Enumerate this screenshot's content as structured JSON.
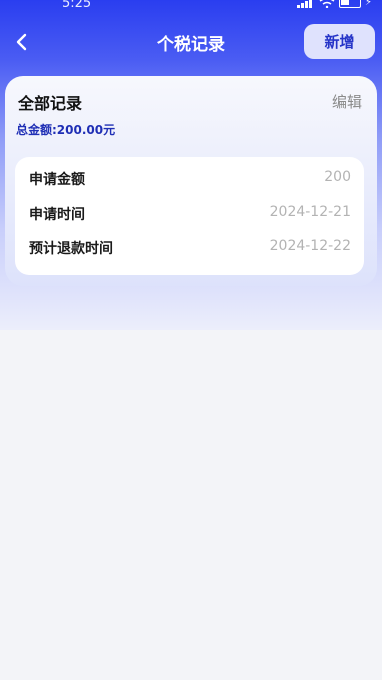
{
  "status": {
    "time": "5:25"
  },
  "nav": {
    "title": "个税记录",
    "add_label": "新增"
  },
  "records": {
    "title": "全部记录",
    "edit_label": "编辑",
    "total": "总金额:200.00元",
    "items": [
      {
        "rows": [
          {
            "label": "申请金额",
            "value": "200"
          },
          {
            "label": "申请时间",
            "value": "2024-12-21"
          },
          {
            "label": "预计退款时间",
            "value": "2024-12-22"
          }
        ]
      }
    ]
  },
  "colors": {
    "header_gradient_top": "#2a3ef0",
    "accent_text": "#1f2fb5",
    "add_button_bg": "#dfe2fd",
    "value_gray": "#b3b3b3",
    "page_bg": "#f3f4f8"
  },
  "icons": {
    "back": "chevron-left-icon"
  }
}
